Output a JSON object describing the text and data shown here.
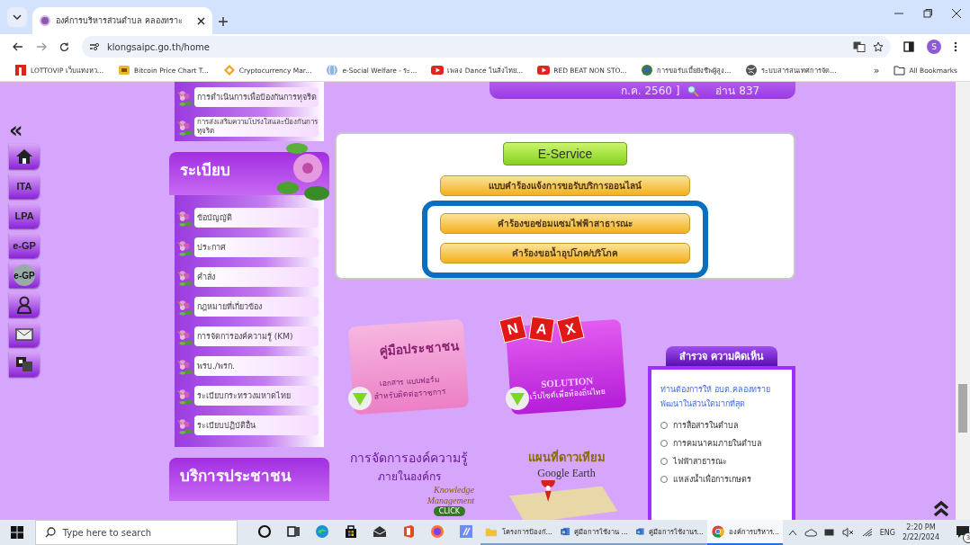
{
  "browser": {
    "tab": {
      "title": "องค์การบริหารส่วนตำบล คลองทราะ",
      "selected": true
    },
    "address": "klongsaipc.go.th/home",
    "profile": "S",
    "bookmarks": [
      {
        "kind": "lotto",
        "label": "LOTTOVIP เว็บแทงหว..."
      },
      {
        "kind": "coin",
        "label": "Bitcoin Price Chart T..."
      },
      {
        "kind": "diamond",
        "label": "Cryptocurrency Mar..."
      },
      {
        "kind": "globe-blue",
        "label": "e-Social Welfare - ระ..."
      },
      {
        "kind": "video",
        "label": "เพลง Dance ในสิ่งไทย..."
      },
      {
        "kind": "video",
        "label": "RED BEAT NON STO..."
      },
      {
        "kind": "emblem",
        "label": "การขอรับเบี้ยยังชีพผู้สูง..."
      },
      {
        "kind": "globe",
        "label": "ระบบสารสนเทศการจัด..."
      }
    ],
    "bookmarks_more": "»",
    "all_bookmarks": "All Bookmarks"
  },
  "page": {
    "side_icons": [
      {
        "kind": "collapse",
        "label": "«"
      },
      {
        "kind": "home"
      },
      {
        "kind": "text",
        "label": "ITA"
      },
      {
        "kind": "text",
        "label": "LPA"
      },
      {
        "kind": "text",
        "label": "e-GP"
      },
      {
        "kind": "globe",
        "label": "e-GP"
      },
      {
        "kind": "person"
      },
      {
        "kind": "mail"
      },
      {
        "kind": "translate"
      }
    ],
    "sidebar_top": [
      "การดำเนินการเพื่อป้องกันการทุจริต",
      "การส่งเสริมความโปร่งใสและป้องกันการทุจริต"
    ],
    "sidebar_section": {
      "title": "ระเบียบ",
      "items": [
        "ข้อบัญญัติ",
        "ประกาศ",
        "คำสั่ง",
        "กฎหมายที่เกี่ยวข้อง",
        "การจัดการองค์ความรู้ (KM)",
        "พรบ./พรก.",
        "ระเบียบกระทรวงมหาดไทย",
        "ระเบียบปฏิบัติอื่น"
      ]
    },
    "sidebar_next_title": "บริการประชาชน",
    "banner": {
      "date": "ก.ค. 2560 ]",
      "views": "อ่าน 837"
    },
    "eservice": {
      "title": "E-Service",
      "links": [
        "แบบคำร้องแจ้งการขอรับบริการออนไลน์"
      ],
      "highlighted_links": [
        "คำร้องขอซ่อมแซมไฟฟ้าสาธารณะ",
        "คำร้องขอน้ำอุปโภค/บริโภค"
      ]
    },
    "tiles": [
      {
        "kind": "manual",
        "title": "คู่มือประชาชน",
        "lines": [
          "เอกสาร แบบฟอร์ม",
          "สำหรับติดต่อราชการ"
        ]
      },
      {
        "kind": "nax",
        "letters": [
          "N",
          "A",
          "X"
        ],
        "title": "SOLUTION",
        "lines": [
          "เว็บไซต์เพื่อท้องถิ่นไทย"
        ]
      },
      {
        "kind": "km",
        "title": "การจัดการองค์ความรู้",
        "lines": [
          "ภายในองค์กร",
          "Knowledge",
          "Management"
        ],
        "button": "CLICK"
      },
      {
        "kind": "map",
        "title": "แผนที่ดาวเทียม",
        "lines": [
          "Google Earth"
        ]
      }
    ],
    "survey": {
      "title": "สำรวจ ความคิดเห็น",
      "question": "ท่านต้องการให้ อบต.คลองทราย พัฒนาในส่วนใดมากที่สุด",
      "options": [
        {
          "label": "การสื่อสารในตำบล",
          "selected": false
        },
        {
          "label": "การคมนาคมภายในตำบล",
          "selected": false
        },
        {
          "label": "ไฟฟ้าสาธารณะ",
          "selected": false
        },
        {
          "label": "แหล่งน้ำเพื่อการเกษตร",
          "selected": false
        }
      ]
    }
  },
  "taskbar": {
    "search_placeholder": "Type here to search",
    "apps": [
      {
        "kind": "cortana",
        "active": false
      },
      {
        "kind": "taskview",
        "active": false
      },
      {
        "kind": "edge",
        "active": false
      },
      {
        "kind": "store",
        "active": false
      },
      {
        "kind": "mail",
        "active": false
      },
      {
        "kind": "office",
        "active": false
      },
      {
        "kind": "firefox",
        "active": false
      },
      {
        "kind": "app",
        "active": false
      },
      {
        "kind": "folder",
        "label": "โครงการป้องกั...",
        "active": false
      },
      {
        "kind": "word",
        "label": "คู่มือการใช้งาน ...",
        "active": false
      },
      {
        "kind": "word",
        "label": "คู่มือการใช้งานร...",
        "active": false
      },
      {
        "kind": "chrome",
        "label": "องค์การบริหาร...",
        "active": true
      }
    ],
    "language": "ENG",
    "time": "2:20 PM",
    "date": "2/22/2024",
    "notifications": "3"
  }
}
